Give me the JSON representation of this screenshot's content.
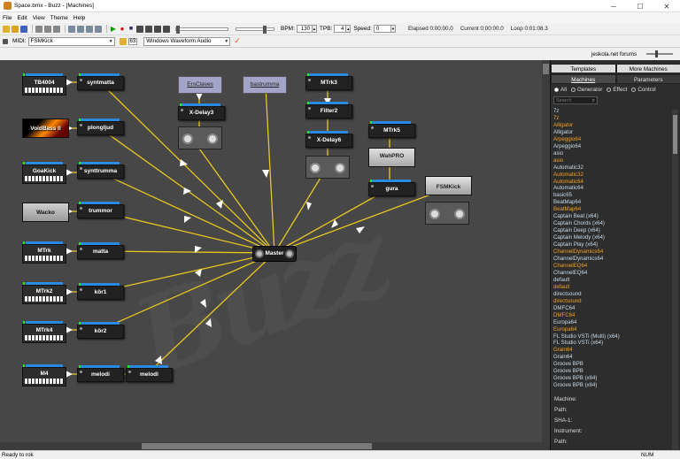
{
  "window": {
    "title": "Space.bmx - Buzz - [Machines]",
    "minimize_glyph": "─",
    "maximize_glyph": "☐",
    "close_glyph": "✕"
  },
  "menu": [
    "File",
    "Edit",
    "View",
    "Theme",
    "Help"
  ],
  "transport": {
    "bpm_label": "BPM:",
    "bpm_value": "130",
    "tpb_label": "TPB:",
    "tpb_value": "4",
    "speed_label": "Speed:",
    "speed_value": "0",
    "elapsed": "Elapsed 0:00:00.0",
    "current": "Current 0:00:00.0",
    "loop": "Loop 0:01:08.3"
  },
  "midi": {
    "label": "MIDI:",
    "selected_machine": "FSMKick",
    "number": "63",
    "audio_driver": "Windows Waveform Audio"
  },
  "forums_link": "jeskola.net forums",
  "machines": {
    "TB4004": "TB4004",
    "synt1": "syntmatta",
    "VoidBass": "VoidBass II",
    "plong": "plongljud",
    "GoaKick": "GoaKick",
    "synttrumma": "synttrumma",
    "Wacko": "Wacko",
    "trummor": "trummor",
    "MTrk": "MTrk",
    "matta": "matta",
    "MTrk2": "MTrk2",
    "kor1": "kör1",
    "MTrk4": "MTrk4",
    "kor2": "kör2",
    "M4": "M4",
    "melodi1": "melodi",
    "melodi2": "melodi",
    "ErsClaves": "ErsClaves",
    "bastrumma": "bastrumma",
    "XDelay3": "X-Delay3",
    "MTrk3": "MTrk3",
    "Filter2": "Filter2",
    "XDelay6": "X-Delay6",
    "MTrk5": "MTrk5",
    "WahPRO": "WahPRO",
    "gura": "gura",
    "FSMKick": "FSMKick",
    "master": "Master"
  },
  "panel": {
    "tabs_top": [
      "Templates",
      "More Machines"
    ],
    "tabs_second": [
      "Machines",
      "Parameters"
    ],
    "filters": [
      "All",
      "Generator",
      "Effect",
      "Control"
    ],
    "selected_filter": "All",
    "search_placeholder": "Search",
    "list": [
      {
        "name": "7z",
        "hi": false
      },
      {
        "name": "7z",
        "hi": true
      },
      {
        "name": "Alligator",
        "hi": true
      },
      {
        "name": "Alligator",
        "hi": false
      },
      {
        "name": "Arpeggio64",
        "hi": true
      },
      {
        "name": "Arpeggio64",
        "hi": false
      },
      {
        "name": "asio",
        "hi": false
      },
      {
        "name": "asio",
        "hi": true
      },
      {
        "name": "Automatic32",
        "hi": false
      },
      {
        "name": "Automatic32",
        "hi": true
      },
      {
        "name": "Automatic64",
        "hi": true
      },
      {
        "name": "Automatic64",
        "hi": false
      },
      {
        "name": "basic65",
        "hi": false
      },
      {
        "name": "BeatMap64",
        "hi": false
      },
      {
        "name": "BeatMap64",
        "hi": true
      },
      {
        "name": "Captain Beat (x64)",
        "hi": false
      },
      {
        "name": "Captain Chords (x64)",
        "hi": false
      },
      {
        "name": "Captain Deep (x64)",
        "hi": false
      },
      {
        "name": "Captain Melody (x64)",
        "hi": false
      },
      {
        "name": "Captain Play (x64)",
        "hi": false
      },
      {
        "name": "ChannelDynamics64",
        "hi": true
      },
      {
        "name": "ChannelDynamics64",
        "hi": false
      },
      {
        "name": "ChannelEQ64",
        "hi": true
      },
      {
        "name": "ChannelEQ64",
        "hi": false
      },
      {
        "name": "default",
        "hi": false
      },
      {
        "name": "default",
        "hi": true
      },
      {
        "name": "directsound",
        "hi": false
      },
      {
        "name": "directsound",
        "hi": true
      },
      {
        "name": "DMFC64",
        "hi": false
      },
      {
        "name": "DMFC64",
        "hi": true
      },
      {
        "name": "Europa64",
        "hi": false
      },
      {
        "name": "Europa64",
        "hi": true
      },
      {
        "name": "FL Studio VSTi (Multi) (x64)",
        "hi": false
      },
      {
        "name": "FL Studio VSTi (x64)",
        "hi": false
      },
      {
        "name": "Grain64",
        "hi": true
      },
      {
        "name": "Grain64",
        "hi": false
      },
      {
        "name": "Groove BPB",
        "hi": false
      },
      {
        "name": "Groove BPB",
        "hi": false
      },
      {
        "name": "Groove BPB (x64)",
        "hi": false
      },
      {
        "name": "Groove BPB (x64)",
        "hi": false
      }
    ],
    "info_labels": [
      "Machine:",
      "Path:",
      "SHA-1:",
      "Instrument:",
      "Path:"
    ]
  },
  "status": {
    "left": "Ready to rok",
    "right": "NUM"
  },
  "colors": {
    "wire": "#e8c81e",
    "workspace": "#474747",
    "highlight": "#f0a020"
  }
}
